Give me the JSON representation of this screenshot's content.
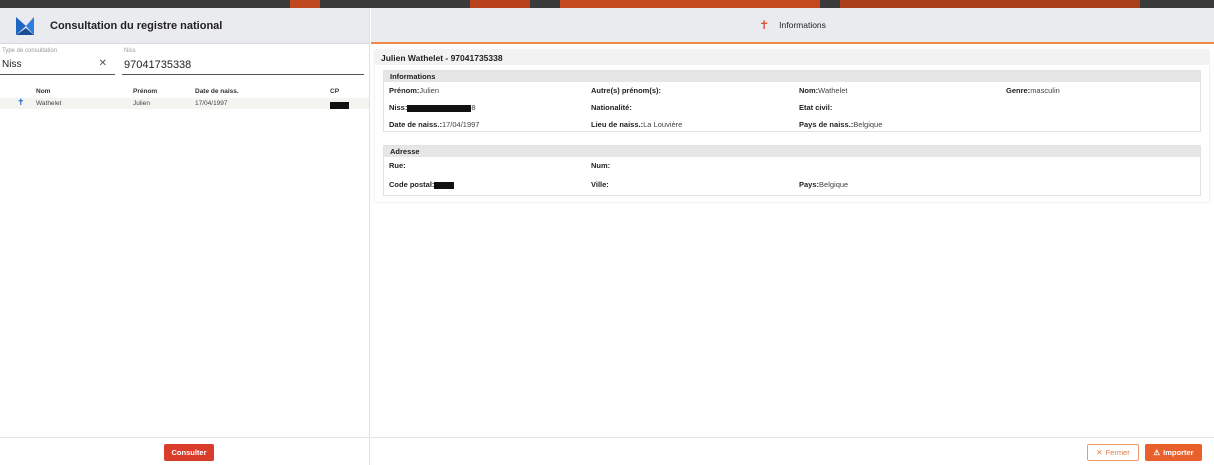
{
  "app": {
    "title": "Consultation du registre national"
  },
  "search": {
    "type_label": "Type de consultation",
    "type_value": "Niss",
    "niss_label": "Niss",
    "niss_value": "97041735338"
  },
  "table": {
    "headers": [
      "Nom",
      "Prénom",
      "Date de naiss.",
      "CP"
    ],
    "rows": [
      {
        "nom": "Wathelet",
        "prenom": "Julien",
        "date": "17/04/1997"
      }
    ]
  },
  "buttons": {
    "consulter": "Consulter",
    "fermer": "Fermer",
    "importer": "Importer"
  },
  "details": {
    "header": "Informations",
    "person_title": "Julien Wathelet - 97041735338",
    "info_section": "Informations",
    "addr_section": "Adresse",
    "prenom_label": "Prénom:",
    "prenom_value": "Julien",
    "autres_label": "Autre(s) prénom(s):",
    "nom_label": "Nom:",
    "nom_value": "Wathelet",
    "genre_label": "Genre:",
    "genre_value": "masculin",
    "niss_label": "Niss:",
    "niss_suffix": "8",
    "nationalite_label": "Nationalité:",
    "etat_label": "Etat civil:",
    "date_label": "Date de naiss.:",
    "date_value": "17/04/1997",
    "lieu_label": "Lieu de naiss.:",
    "lieu_value": "La Louvière",
    "pays_naiss_label": "Pays de naiss.:",
    "pays_naiss_value": "Belgique",
    "rue_label": "Rue:",
    "num_label": "Num:",
    "cp_label": "Code postal:",
    "ville_label": "Ville:",
    "pays_label": "Pays:",
    "pays_value": "Belgique"
  },
  "colors": {
    "accent": "#e8612d",
    "consulter": "#d93c2a",
    "header_bg": "#e9ebee"
  }
}
